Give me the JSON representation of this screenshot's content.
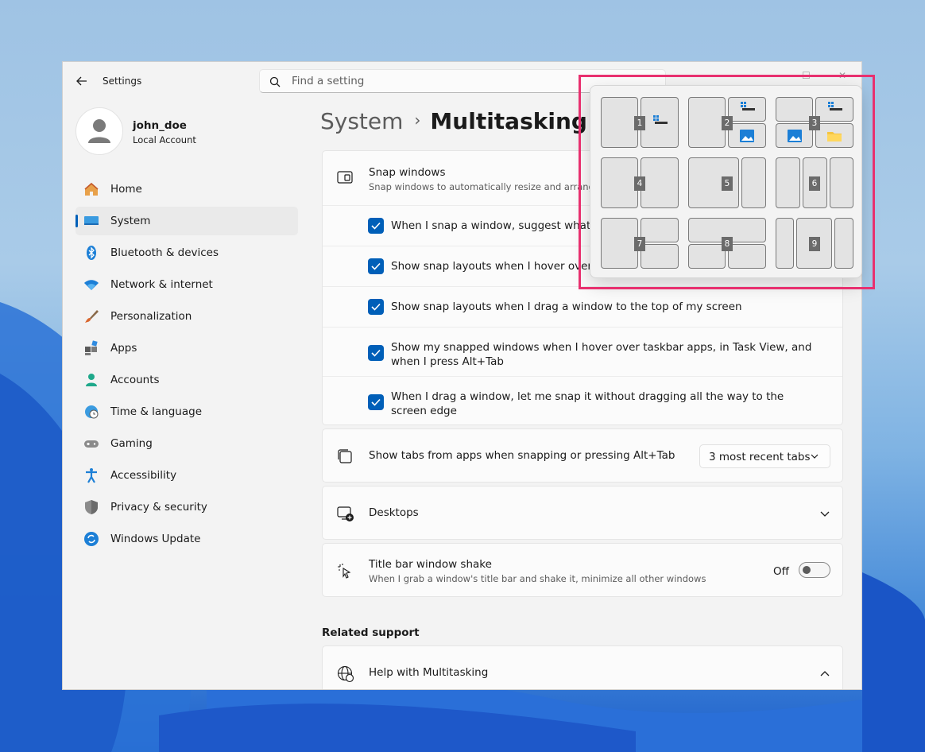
{
  "window": {
    "app_title": "Settings",
    "search_placeholder": "Find a setting"
  },
  "profile": {
    "username": "john_doe",
    "account_type": "Local Account"
  },
  "nav": [
    {
      "label": "Home",
      "icon": "home-icon"
    },
    {
      "label": "System",
      "icon": "system-icon",
      "active": true
    },
    {
      "label": "Bluetooth & devices",
      "icon": "bluetooth-icon"
    },
    {
      "label": "Network & internet",
      "icon": "wifi-icon"
    },
    {
      "label": "Personalization",
      "icon": "brush-icon"
    },
    {
      "label": "Apps",
      "icon": "apps-icon"
    },
    {
      "label": "Accounts",
      "icon": "accounts-icon"
    },
    {
      "label": "Time & language",
      "icon": "clock-globe-icon"
    },
    {
      "label": "Gaming",
      "icon": "gamepad-icon"
    },
    {
      "label": "Accessibility",
      "icon": "accessibility-icon"
    },
    {
      "label": "Privacy & security",
      "icon": "shield-icon"
    },
    {
      "label": "Windows Update",
      "icon": "update-icon"
    }
  ],
  "breadcrumb": {
    "parent": "System",
    "current": "Multitasking"
  },
  "snap": {
    "title": "Snap windows",
    "desc": "Snap windows to automatically resize and arrange t",
    "options": [
      {
        "label": "When I snap a window, suggest what I ca",
        "checked": true
      },
      {
        "label": "Show snap layouts when I hover over a w",
        "checked": true
      },
      {
        "label": "Show snap layouts when I drag a window to the top of my screen",
        "checked": true
      },
      {
        "label": "Show my snapped windows when I hover over taskbar apps, in Task View, and when I press Alt+Tab",
        "checked": true
      },
      {
        "label": "When I drag a window, let me snap it without dragging all the way to the screen edge",
        "checked": true
      }
    ]
  },
  "tabs_setting": {
    "title": "Show tabs from apps when snapping or pressing Alt+Tab",
    "value": "3 most recent tabs"
  },
  "desktops": {
    "title": "Desktops"
  },
  "shake": {
    "title": "Title bar window shake",
    "desc": "When I grab a window's title bar and shake it, minimize all other windows",
    "state": "Off"
  },
  "related": {
    "heading": "Related support",
    "help_title": "Help with Multitasking"
  },
  "snap_layouts": [
    "1",
    "2",
    "3",
    "4",
    "5",
    "6",
    "7",
    "8",
    "9"
  ],
  "colors": {
    "accent": "#005fb8",
    "highlight_box": "#e8306f"
  }
}
